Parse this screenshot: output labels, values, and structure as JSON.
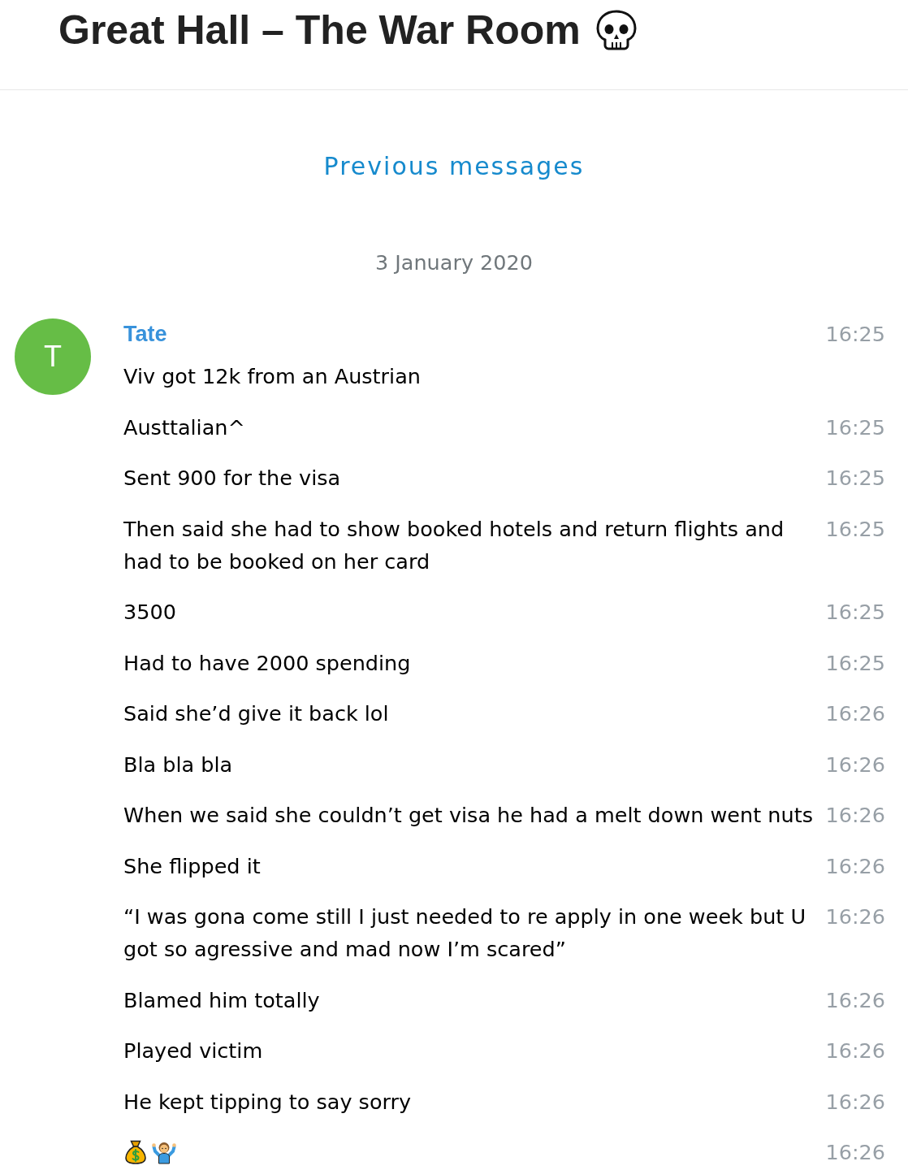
{
  "header": {
    "title": "Great Hall – The War Room"
  },
  "history": {
    "link": "Previous messages"
  },
  "date_separator": "3 January 2020",
  "message_group": {
    "sender": "Tate",
    "avatar_initial": "T",
    "messages": [
      {
        "kind": "text",
        "text": "Viv got 12k from an Austrian",
        "time": "16:25"
      },
      {
        "kind": "text",
        "text": "Austtalian^",
        "time": "16:25"
      },
      {
        "kind": "text",
        "text": "Sent 900 for the visa",
        "time": "16:25"
      },
      {
        "kind": "text",
        "text": "Then said she had to show booked hotels and return flights and had to be booked on her card",
        "time": "16:25"
      },
      {
        "kind": "text",
        "text": "3500",
        "time": "16:25"
      },
      {
        "kind": "text",
        "text": "Had to have 2000 spending",
        "time": "16:25"
      },
      {
        "kind": "text",
        "text": "Said she’d give it back lol",
        "time": "16:26"
      },
      {
        "kind": "text",
        "text": "Bla bla bla",
        "time": "16:26"
      },
      {
        "kind": "text",
        "text": "When we said she couldn’t get visa he had a melt down went nuts",
        "time": "16:26"
      },
      {
        "kind": "text",
        "text": "She flipped it",
        "time": "16:26"
      },
      {
        "kind": "text",
        "text": "“I was gona come still I just needed to re apply in one week but U got so agressive and mad now I’m scared”",
        "time": "16:26"
      },
      {
        "kind": "text",
        "text": "Blamed him totally",
        "time": "16:26"
      },
      {
        "kind": "text",
        "text": "Played victim",
        "time": "16:26"
      },
      {
        "kind": "text",
        "text": "He kept tipping to say sorry",
        "time": "16:26"
      },
      {
        "kind": "emoji",
        "time": "16:26"
      }
    ]
  }
}
